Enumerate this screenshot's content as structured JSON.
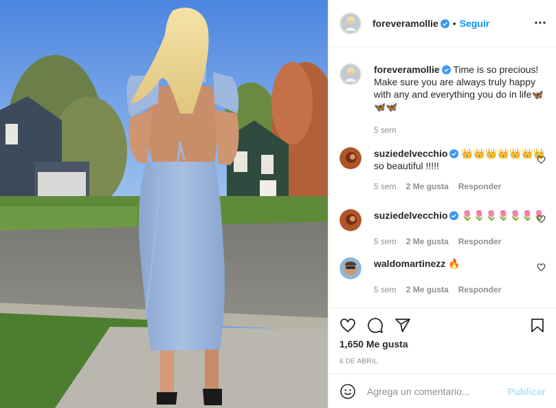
{
  "post": {
    "username": "foreveramollie",
    "follow_label": "Seguir",
    "separator": "•"
  },
  "caption": {
    "username": "foreveramollie",
    "text": "Time is so precious! Make sure you are always truly happy with any and everything you do in life🦋🦋🦋",
    "age": "5 sem"
  },
  "comments": [
    {
      "username": "suziedelvecchio",
      "verified": true,
      "text": "👑👑👑👑👑👑👑 so beautiful !!!!!",
      "age": "5 sem",
      "likes": "2 Me gusta",
      "reply": "Responder"
    },
    {
      "username": "suziedelvecchio",
      "verified": true,
      "text": "🌷🌷🌷🌷🌷🌷🌷",
      "age": "5 sem",
      "likes": "2 Me gusta",
      "reply": "Responder"
    },
    {
      "username": "waldomartinezz",
      "verified": false,
      "text": "🔥",
      "age": "5 sem",
      "likes": "2 Me gusta",
      "reply": "Responder"
    }
  ],
  "stats": {
    "likes_label": "1,650 Me gusta",
    "date": "6 DE ABRIL"
  },
  "add_comment": {
    "placeholder": "Agrega un comentario...",
    "publish_label": "Publicar"
  },
  "icons": {
    "more": "more-options-icon",
    "like": "heart-icon",
    "comment": "comment-icon",
    "share": "share-icon",
    "save": "bookmark-icon",
    "emoji": "emoji-icon",
    "verified": "verified-badge-icon"
  },
  "colors": {
    "accent": "#0095f6",
    "verified": "#3897f0",
    "muted": "#8e8e8e",
    "publish_disabled": "#b2dffc"
  }
}
